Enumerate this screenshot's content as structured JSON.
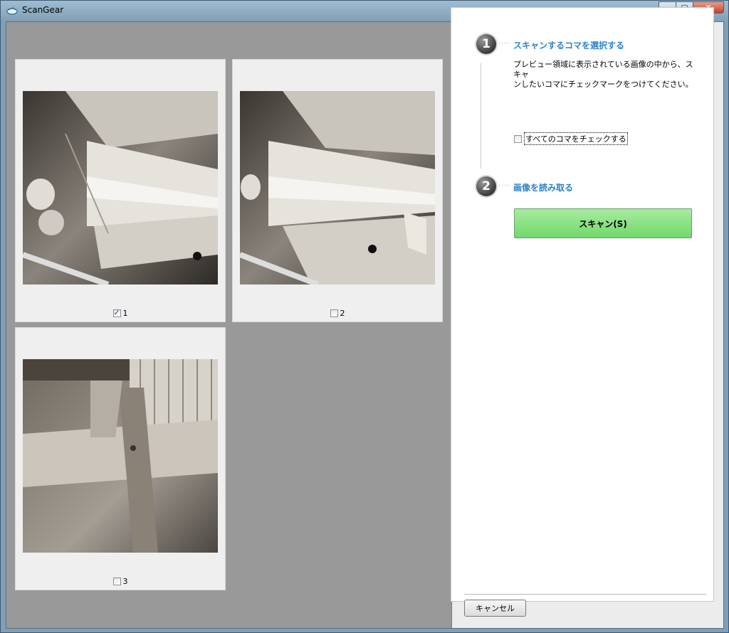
{
  "window": {
    "title": "ScanGear"
  },
  "frames": [
    {
      "number": "1",
      "checked": true
    },
    {
      "number": "2",
      "checked": false
    },
    {
      "number": "3",
      "checked": false
    }
  ],
  "step1": {
    "number": "1",
    "title": "スキャンするコマを選択する",
    "description_line1": "プレビュー領域に表示されている画像の中から、スキャ",
    "description_line2": "ンしたいコマにチェックマークをつけてください。",
    "check_all_label": "すべてのコマをチェックする"
  },
  "step2": {
    "number": "2",
    "title": "画像を読み取る",
    "scan_label": "スキャン(S)"
  },
  "cancel_label": "キャンセル",
  "colors": {
    "accent": "#2e84c8",
    "scan_button": "#8ee488",
    "preview_bg": "#999999"
  }
}
